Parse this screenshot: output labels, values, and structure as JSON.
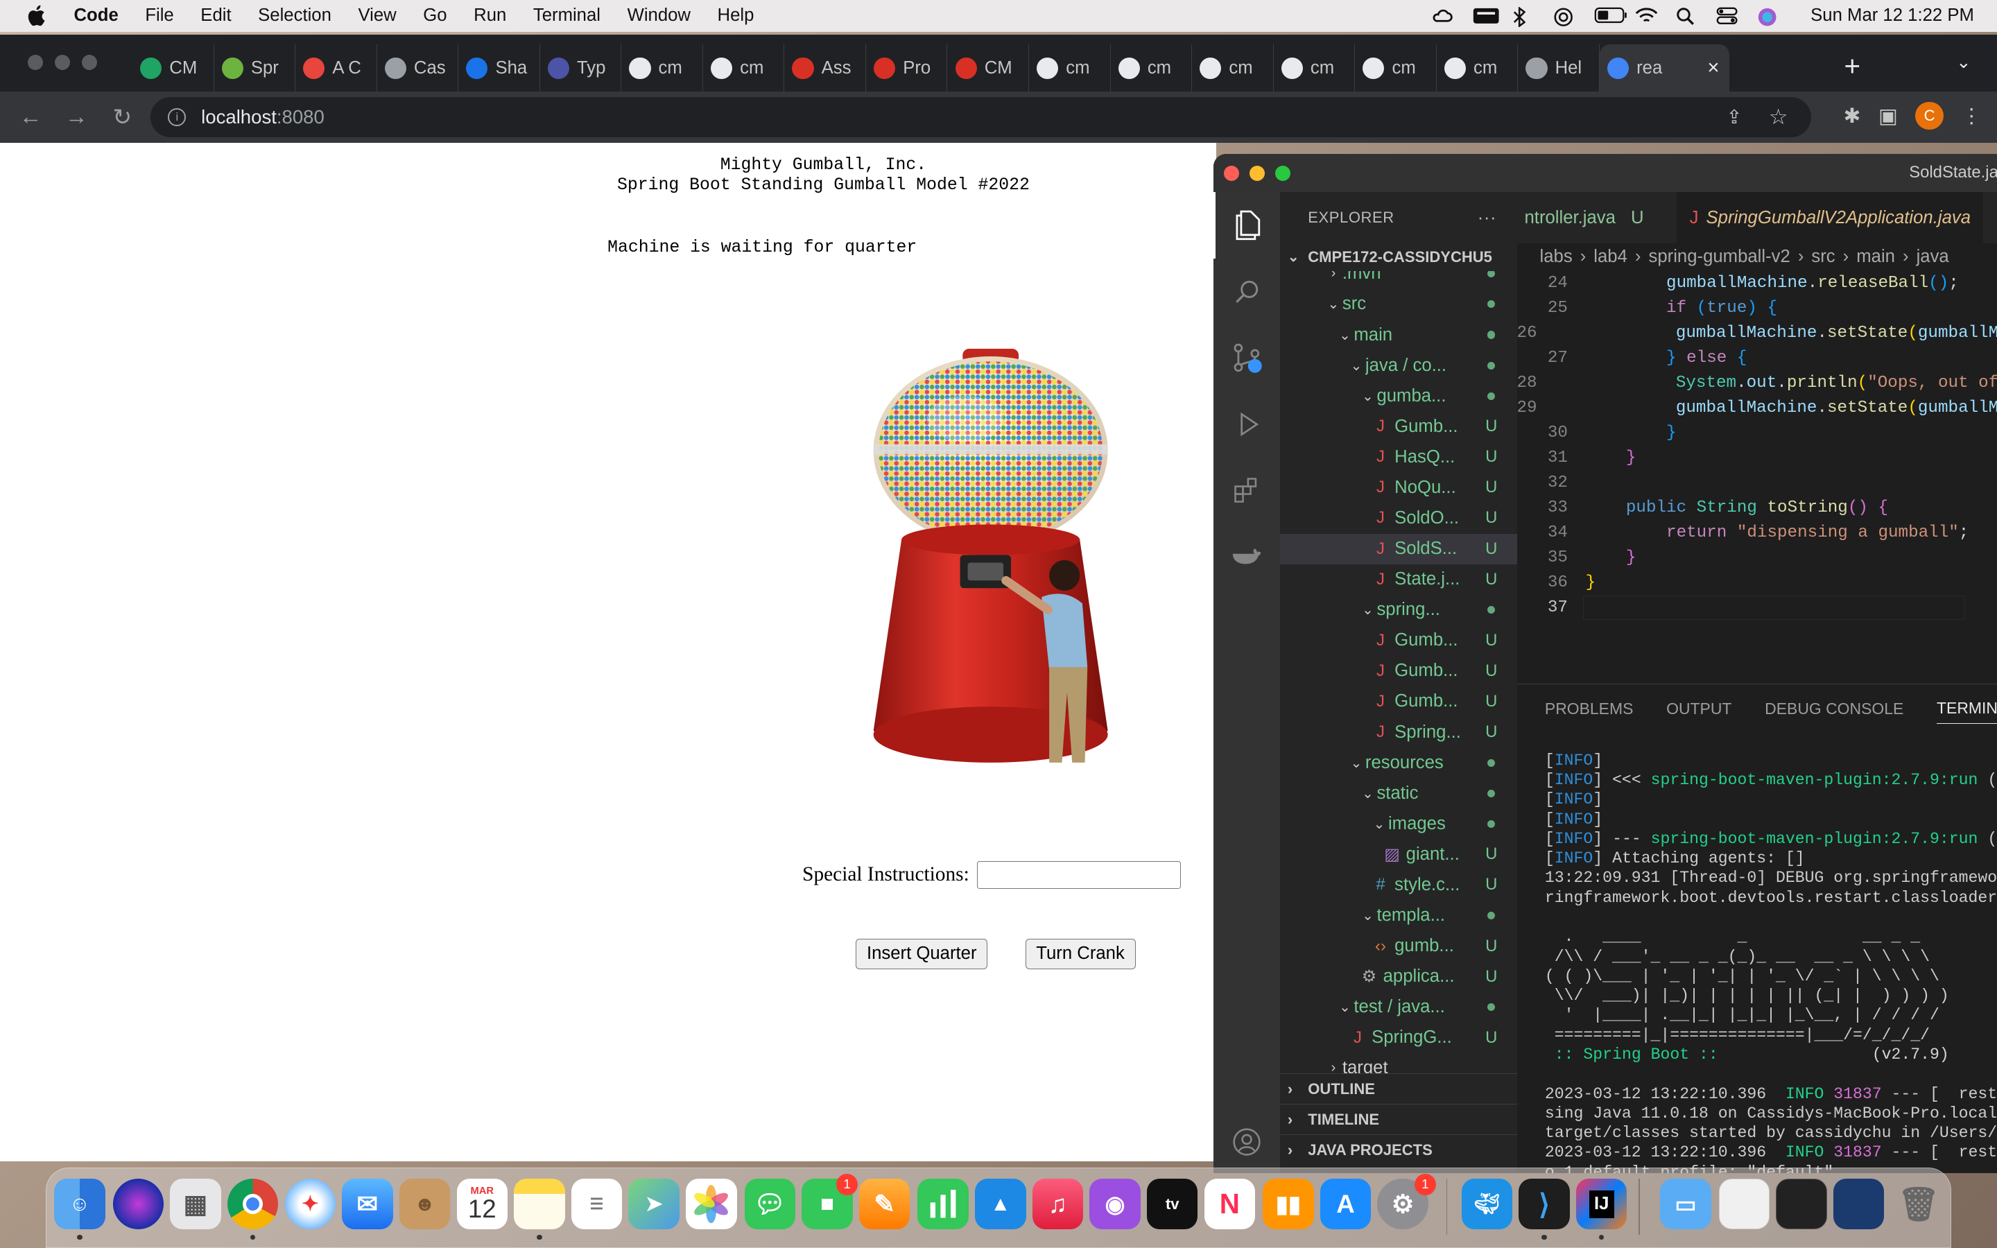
{
  "menubar": {
    "app": "Code",
    "items": [
      "File",
      "Edit",
      "Selection",
      "View",
      "Go",
      "Run",
      "Terminal",
      "Window",
      "Help"
    ],
    "clock": "Sun Mar 12  1:22 PM"
  },
  "browser": {
    "tabs": [
      {
        "label": "CM",
        "color": "#1fa463"
      },
      {
        "label": "Spr",
        "color": "#6db33f"
      },
      {
        "label": "A C",
        "color": "#e8453c"
      },
      {
        "label": "Cas",
        "color": "#9aa0a6"
      },
      {
        "label": "Sha",
        "color": "#1a73e8"
      },
      {
        "label": "Typ",
        "color": "#4b54a6"
      },
      {
        "label": "cm",
        "color": "#e8eaed"
      },
      {
        "label": "cm",
        "color": "#e8eaed"
      },
      {
        "label": "Ass",
        "color": "#d93025"
      },
      {
        "label": "Pro",
        "color": "#d93025"
      },
      {
        "label": "CM",
        "color": "#d93025"
      },
      {
        "label": "cm",
        "color": "#e8eaed"
      },
      {
        "label": "cm",
        "color": "#e8eaed"
      },
      {
        "label": "cm",
        "color": "#e8eaed"
      },
      {
        "label": "cm",
        "color": "#e8eaed"
      },
      {
        "label": "cm",
        "color": "#e8eaed"
      },
      {
        "label": "cm",
        "color": "#e8eaed"
      },
      {
        "label": "Hel",
        "color": "#9aa0a6"
      },
      {
        "label": "rea",
        "color": "#4285f4"
      }
    ],
    "url_host": "localhost",
    "url_port": ":8080",
    "profile_initial": "C"
  },
  "page": {
    "company_line1": "Mighty Gumball, Inc.",
    "company_line2": "Spring Boot Standing Gumball Model #2022",
    "status": "Machine is waiting for quarter",
    "instructions_label": "Special Instructions:",
    "instructions_value": "",
    "insert_button": "Insert Quarter",
    "crank_button": "Turn Crank"
  },
  "vscode": {
    "window_title": "SoldState.java",
    "explorer_title": "EXPLORER",
    "workspace": "CMPE172-CASSIDYCHU5",
    "tree": [
      {
        "label": ".mvn",
        "indent": 3,
        "chev": "›",
        "status": "dot",
        "partial": true
      },
      {
        "label": "src",
        "indent": 3,
        "chev": "⌄",
        "status": "dot"
      },
      {
        "label": "main",
        "indent": 4,
        "chev": "⌄",
        "status": "dot"
      },
      {
        "label": "java / co...",
        "indent": 5,
        "chev": "⌄",
        "status": "dot"
      },
      {
        "label": "gumba...",
        "indent": 6,
        "chev": "⌄",
        "status": "dot"
      },
      {
        "label": "Gumb...",
        "indent": 7,
        "icon": "J",
        "status": "U"
      },
      {
        "label": "HasQ...",
        "indent": 7,
        "icon": "J",
        "status": "U"
      },
      {
        "label": "NoQu...",
        "indent": 7,
        "icon": "J",
        "status": "U"
      },
      {
        "label": "SoldO...",
        "indent": 7,
        "icon": "J",
        "status": "U"
      },
      {
        "label": "SoldS...",
        "indent": 7,
        "icon": "J",
        "status": "U",
        "selected": true
      },
      {
        "label": "State.j...",
        "indent": 7,
        "icon": "J",
        "status": "U"
      },
      {
        "label": "spring...",
        "indent": 6,
        "chev": "⌄",
        "status": "dot"
      },
      {
        "label": "Gumb...",
        "indent": 7,
        "icon": "J",
        "status": "U"
      },
      {
        "label": "Gumb...",
        "indent": 7,
        "icon": "J",
        "status": "U"
      },
      {
        "label": "Gumb...",
        "indent": 7,
        "icon": "J",
        "status": "U"
      },
      {
        "label": "Spring...",
        "indent": 7,
        "icon": "J",
        "status": "U"
      },
      {
        "label": "resources",
        "indent": 5,
        "chev": "⌄",
        "status": "dot"
      },
      {
        "label": "static",
        "indent": 6,
        "chev": "⌄",
        "status": "dot"
      },
      {
        "label": "images",
        "indent": 7,
        "chev": "⌄",
        "status": "dot"
      },
      {
        "label": "giant...",
        "indent": 8,
        "icon": "img",
        "status": "U"
      },
      {
        "label": "style.c...",
        "indent": 7,
        "icon": "#",
        "status": "U"
      },
      {
        "label": "templa...",
        "indent": 6,
        "chev": "⌄",
        "status": "dot"
      },
      {
        "label": "gumb...",
        "indent": 7,
        "icon": "<>",
        "status": "U"
      },
      {
        "label": "applica...",
        "indent": 6,
        "icon": "gear",
        "status": "U"
      },
      {
        "label": "test / java...",
        "indent": 4,
        "chev": "⌄",
        "status": "dot"
      },
      {
        "label": "SpringG...",
        "indent": 5,
        "icon": "J",
        "status": "U"
      },
      {
        "label": "target",
        "indent": 3,
        "chev": "›",
        "status": "none",
        "plain": true
      }
    ],
    "sections": [
      "OUTLINE",
      "TIMELINE",
      "JAVA PROJECTS"
    ],
    "editor_tabs": [
      {
        "label": "ntroller.java",
        "status": "U"
      },
      {
        "label": "SpringGumballV2Application.java",
        "active": true
      }
    ],
    "breadcrumb": [
      "labs",
      "lab4",
      "spring-gumball-v2",
      "src",
      "main",
      "java"
    ],
    "code_start_line": 24,
    "current_line": 37,
    "panel_tabs": [
      "PROBLEMS",
      "OUTPUT",
      "DEBUG CONSOLE",
      "TERMINAL"
    ]
  },
  "dock": {
    "calendar_month": "MAR",
    "calendar_day": "12",
    "facetime_badge": "1",
    "settings_badge": "1"
  }
}
